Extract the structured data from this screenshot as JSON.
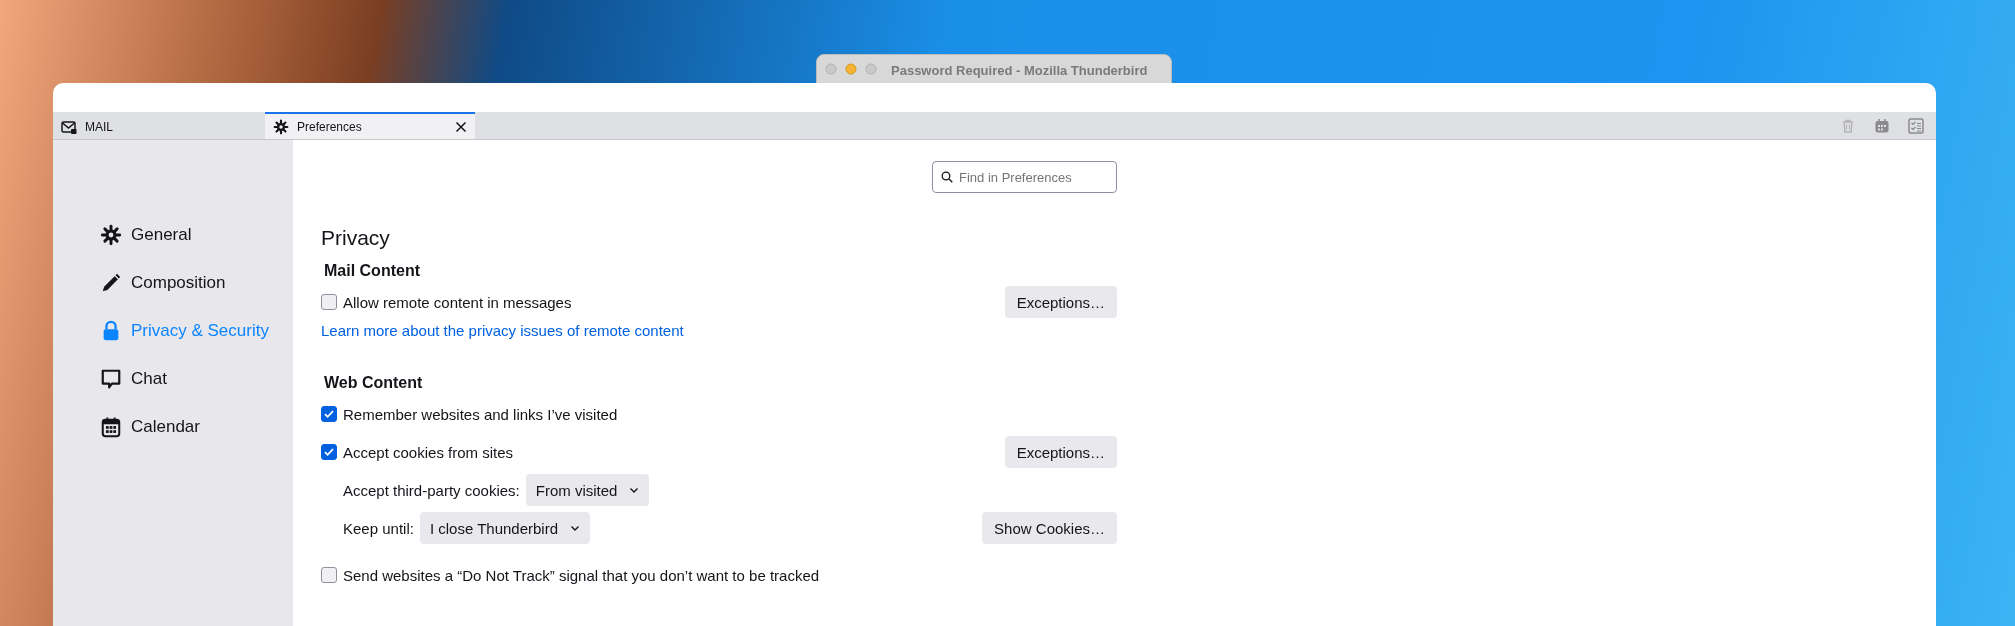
{
  "background_window": {
    "title": "Password Required - Mozilla Thunderbird"
  },
  "tabs": [
    {
      "label": "MAIL",
      "kind": "mail",
      "selected": false
    },
    {
      "label": "Preferences",
      "kind": "prefs",
      "selected": true
    }
  ],
  "search": {
    "placeholder": "Find in Preferences"
  },
  "sidebar": {
    "items": [
      {
        "label": "General",
        "kind": "gear",
        "selected": false
      },
      {
        "label": "Composition",
        "kind": "pencil",
        "selected": false
      },
      {
        "label": "Privacy & Security",
        "kind": "lock",
        "selected": true
      },
      {
        "label": "Chat",
        "kind": "chat",
        "selected": false
      },
      {
        "label": "Calendar",
        "kind": "calendar",
        "selected": false
      }
    ]
  },
  "section": {
    "title": "Privacy",
    "groups": [
      {
        "heading": "Mail Content",
        "rows": [
          {
            "kind": "checkbox",
            "label": "Allow remote content in messages",
            "checked": false,
            "button": "Exceptions…"
          },
          {
            "kind": "link",
            "label": "Learn more about the privacy issues of remote content"
          }
        ]
      },
      {
        "heading": "Web Content",
        "rows": [
          {
            "kind": "checkbox",
            "label": "Remember websites and links I’ve visited",
            "checked": true
          },
          {
            "kind": "checkbox",
            "label": "Accept cookies from sites",
            "checked": true,
            "button": "Exceptions…"
          },
          {
            "kind": "select",
            "label": "Accept third-party cookies:",
            "value": "From visited"
          },
          {
            "kind": "select",
            "label": "Keep until:",
            "value": "I close Thunderbird",
            "button": "Show Cookies…"
          },
          {
            "kind": "checkbox",
            "label": "Send websites a “Do Not Track” signal that you don’t want to be tracked",
            "checked": false
          }
        ]
      }
    ]
  }
}
